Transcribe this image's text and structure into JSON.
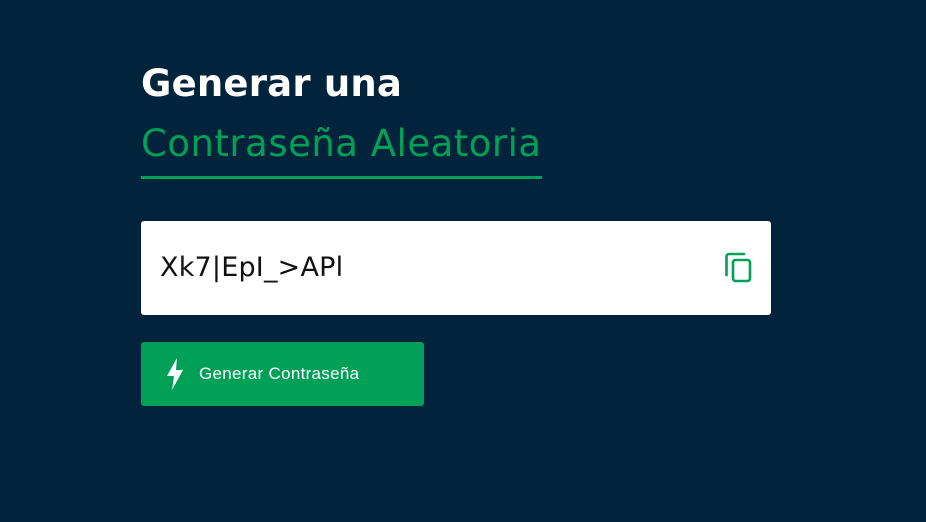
{
  "header": {
    "title_line1": "Generar una",
    "title_line2": "Contraseña Aleatoria"
  },
  "password": {
    "value": "Xk7|EpI_>APl",
    "copy_icon": "copy-icon"
  },
  "actions": {
    "generate_label": "Generar Contraseña",
    "generate_icon": "bolt-icon"
  },
  "colors": {
    "background": "#01233b",
    "accent": "#00a057",
    "text_light": "#ffffff"
  }
}
